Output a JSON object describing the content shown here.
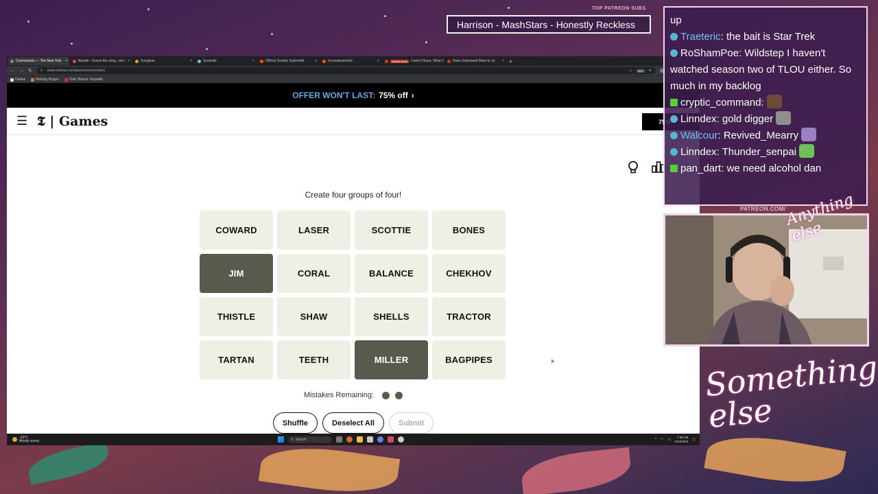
{
  "stream": {
    "patreon_label": "TOP PATREON SUBS",
    "patreon_banner": "Harrison - MashStars - Honestly Reckless",
    "patreon_url": "PATREON.COM/",
    "brand_script": "Anything else",
    "brand_large": "Something else",
    "chat": [
      {
        "type": "text",
        "text": "up"
      },
      {
        "user": "Traeteric",
        "user_color": "blue",
        "badge": "circle",
        "msg": "the bait is Star Trek"
      },
      {
        "user": "RoShamPoe",
        "user_color": "white",
        "badge": "circle",
        "msg": "Wildstep I haven't watched season two of TLOU either. So much in my backlog"
      },
      {
        "user": "cryptic_command",
        "user_color": "white",
        "badge": "square",
        "msg": "",
        "emote": "brown"
      },
      {
        "user": "Linndex",
        "user_color": "white",
        "badge": "circle",
        "msg": "gold digger",
        "emote": "grey"
      },
      {
        "user": "Walcour",
        "user_color": "blue",
        "badge": "circle",
        "msg": "Revived_Mearry",
        "emote": "purple"
      },
      {
        "user": "Linndex",
        "user_color": "white",
        "badge": "circle",
        "msg": "Thunder_senpai",
        "emote": "green"
      },
      {
        "user": "pan_dart",
        "user_color": "white",
        "badge": "square",
        "msg": "we need alcohol dan"
      }
    ]
  },
  "browser": {
    "tabs": [
      {
        "label": "Connections — The New York",
        "active": true,
        "color": "#888"
      },
      {
        "label": "Bandle - Guess the song, one i",
        "color": "#e05050"
      },
      {
        "label": "Songless",
        "color": "#f0a020"
      },
      {
        "label": "Scrandle",
        "color": "#7bd"
      },
      {
        "label": "Official Destiny Subreddit",
        "color": "#ff5500"
      },
      {
        "label": "r/LivestreamFail",
        "color": "#ff5500"
      },
      {
        "label": "Cartel Chaos: What Comes Nex",
        "color": "#e03030",
        "badge": "Ballots News"
      },
      {
        "label": "Does Greenland Want to Jo",
        "color": "#e03030"
      }
    ],
    "url": "www.nytimes.com/games/connections",
    "zoom": "90%",
    "bookmarks": [
      {
        "label": "Dailies",
        "color": "#ddd"
      },
      {
        "label": "Nothing Burger",
        "color": "#e07a30"
      },
      {
        "label": "Clair Obscur: Expediti...",
        "color": "#c33"
      }
    ]
  },
  "nyt": {
    "offer_lead": "OFFER WON'T LAST:",
    "offer_deal": "75% off",
    "offer_chevron": "›",
    "logo": "Games",
    "subscribe_label": "75%",
    "instructions": "Create four groups of four!",
    "cards": [
      {
        "word": "COWARD",
        "selected": false
      },
      {
        "word": "LASER",
        "selected": false
      },
      {
        "word": "SCOTTIE",
        "selected": false
      },
      {
        "word": "BONES",
        "selected": false
      },
      {
        "word": "JIM",
        "selected": true
      },
      {
        "word": "CORAL",
        "selected": false
      },
      {
        "word": "BALANCE",
        "selected": false
      },
      {
        "word": "CHEKHOV",
        "selected": false
      },
      {
        "word": "THISTLE",
        "selected": false
      },
      {
        "word": "SHAW",
        "selected": false
      },
      {
        "word": "SHELLS",
        "selected": false
      },
      {
        "word": "TRACTOR",
        "selected": false
      },
      {
        "word": "TARTAN",
        "selected": false
      },
      {
        "word": "TEETH",
        "selected": false
      },
      {
        "word": "MILLER",
        "selected": true
      },
      {
        "word": "BAGPIPES",
        "selected": false
      }
    ],
    "mistakes_label": "Mistakes Remaining:",
    "mistakes_remaining": 2,
    "shuffle_label": "Shuffle",
    "deselect_label": "Deselect All",
    "submit_label": "Submit"
  },
  "taskbar": {
    "temperature": "-15°C",
    "weather": "Mostly sunny",
    "search_placeholder": "Search",
    "time": "7:39 AM",
    "date": "2/24/2026"
  }
}
